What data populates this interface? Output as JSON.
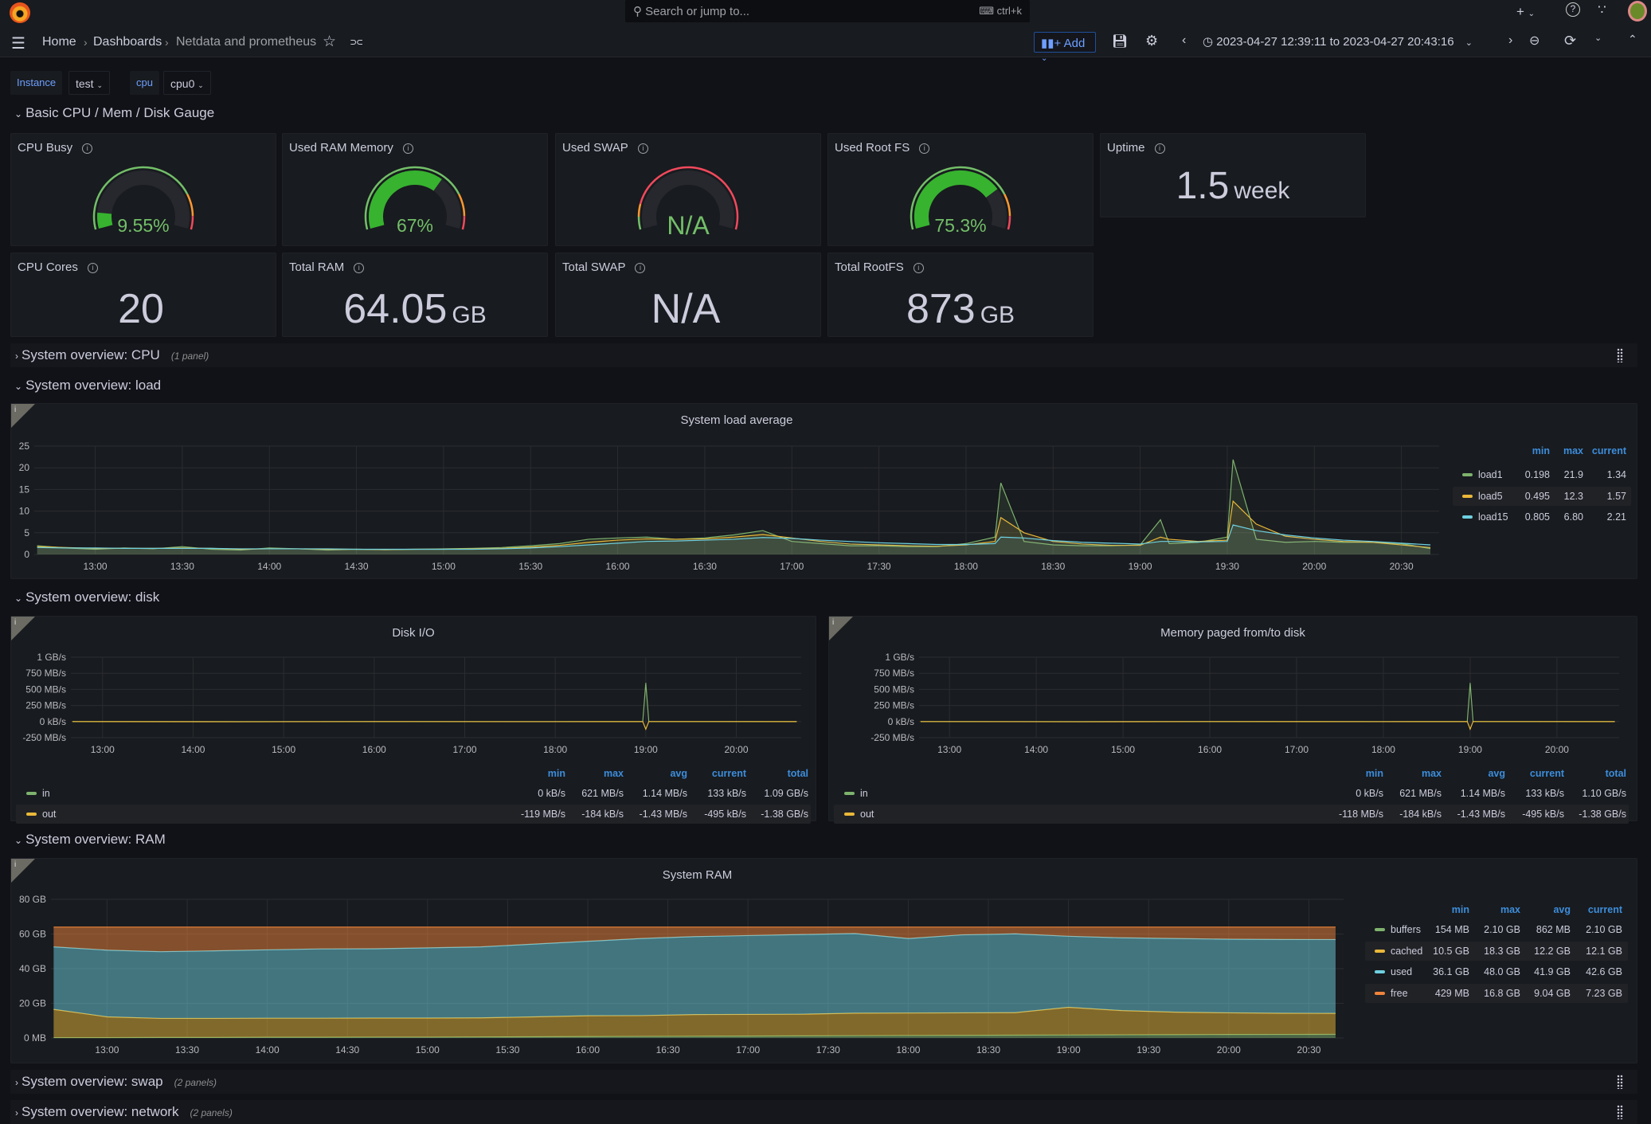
{
  "topbar": {
    "search_placeholder": "Search or jump to...",
    "search_shortcut": "ctrl+k",
    "new_label": "+",
    "icons": [
      "grafana-logo",
      "search-icon",
      "keyboard-icon",
      "plus-icon",
      "help-icon",
      "rss-icon",
      "avatar"
    ]
  },
  "nav": {
    "breadcrumbs": [
      "Home",
      "Dashboards",
      "Netdata and prometheus"
    ],
    "add_label": "Add",
    "time_range": "2023-04-27 12:39:11 to 2023-04-27 20:43:16",
    "accent": "#6e9fff"
  },
  "variables": [
    {
      "label": "Instance",
      "value": "test"
    },
    {
      "label": "cpu",
      "value": "cpu0"
    }
  ],
  "rows": {
    "basic": "Basic CPU / Mem / Disk Gauge",
    "cpu": {
      "title": "System overview: CPU",
      "count": "(1 panel)"
    },
    "load": "System overview: load",
    "disk": "System overview: disk",
    "ram": "System overview: RAM",
    "swap": {
      "title": "System overview: swap",
      "count": "(2 panels)"
    },
    "network": {
      "title": "System overview: network",
      "count": "(2 panels)"
    }
  },
  "gauges": [
    {
      "title": "CPU Busy",
      "value": "9.55%",
      "percent": 9.55
    },
    {
      "title": "Used RAM Memory",
      "value": "67%",
      "percent": 67
    },
    {
      "title": "Used SWAP",
      "value": "N/A",
      "percent": null
    },
    {
      "title": "Used Root FS",
      "value": "75.3%",
      "percent": 75.3
    }
  ],
  "stats": [
    {
      "title": "Uptime",
      "value": "1.5",
      "unit": "week"
    },
    {
      "title": "CPU Cores",
      "value": "20",
      "unit": ""
    },
    {
      "title": "Total RAM",
      "value": "64.05",
      "unit": "GB"
    },
    {
      "title": "Total SWAP",
      "value": "N/A",
      "unit": ""
    },
    {
      "title": "Total RootFS",
      "value": "873",
      "unit": "GB"
    }
  ],
  "panel_corner_label": "i",
  "chart_data": [
    {
      "type": "line",
      "title": "System load average",
      "xlim": [
        "12:39",
        "20:43"
      ],
      "ylim": [
        0,
        25
      ],
      "yticks": [
        {
          "v": 0,
          "label": "0"
        },
        {
          "v": 5,
          "label": "5"
        },
        {
          "v": 10,
          "label": "10"
        },
        {
          "v": 15,
          "label": "15"
        },
        {
          "v": 20,
          "label": "20"
        },
        {
          "v": 25,
          "label": "25"
        }
      ],
      "xticks": [
        "13:00",
        "13:30",
        "14:00",
        "14:30",
        "15:00",
        "15:30",
        "16:00",
        "16:30",
        "17:00",
        "17:30",
        "18:00",
        "18:30",
        "19:00",
        "19:30",
        "20:00",
        "20:30"
      ],
      "x": [
        "12:40",
        "12:50",
        "13:00",
        "13:10",
        "13:20",
        "13:30",
        "13:40",
        "13:50",
        "14:00",
        "14:10",
        "14:20",
        "14:30",
        "14:40",
        "14:50",
        "15:00",
        "15:10",
        "15:20",
        "15:30",
        "15:40",
        "15:50",
        "16:00",
        "16:10",
        "16:20",
        "16:30",
        "16:40",
        "16:50",
        "17:00",
        "17:10",
        "17:20",
        "17:30",
        "17:40",
        "17:50",
        "18:00",
        "18:10",
        "18:12",
        "18:20",
        "18:30",
        "18:40",
        "18:50",
        "19:00",
        "19:07",
        "19:10",
        "19:20",
        "19:30",
        "19:32",
        "19:40",
        "19:50",
        "20:00",
        "20:10",
        "20:20",
        "20:30",
        "20:40"
      ],
      "legend_columns": [
        "min",
        "max",
        "current"
      ],
      "series": [
        {
          "name": "load1",
          "color": "#7eb26d",
          "values": [
            2,
            1.5,
            1.2,
            1.5,
            1.3,
            1.8,
            1.2,
            1.0,
            1.5,
            1.3,
            1.0,
            1.2,
            1.1,
            1.2,
            1.3,
            1.4,
            1.6,
            2.0,
            2.5,
            3.5,
            3.8,
            4.0,
            3.5,
            3.8,
            4.5,
            5.5,
            3.0,
            2.5,
            2.0,
            2.0,
            1.8,
            1.8,
            2.5,
            4.0,
            16.5,
            3.0,
            2.2,
            2.0,
            2.0,
            2.2,
            8.0,
            2.5,
            2.8,
            4.0,
            21.9,
            3.5,
            2.8,
            3.0,
            2.8,
            2.8,
            2.5,
            1.34
          ],
          "stats": [
            "0.198",
            "21.9",
            "1.34"
          ]
        },
        {
          "name": "load5",
          "color": "#eab839",
          "values": [
            1.8,
            1.6,
            1.4,
            1.4,
            1.4,
            1.5,
            1.4,
            1.2,
            1.3,
            1.3,
            1.2,
            1.2,
            1.1,
            1.2,
            1.2,
            1.3,
            1.4,
            1.7,
            2.1,
            2.8,
            3.3,
            3.6,
            3.5,
            3.6,
            4.0,
            4.6,
            3.8,
            3.0,
            2.4,
            2.2,
            2.0,
            1.9,
            2.2,
            3.0,
            8.5,
            5.0,
            3.0,
            2.4,
            2.1,
            2.1,
            4.0,
            3.5,
            3.0,
            3.3,
            12.3,
            7.0,
            4.2,
            3.5,
            3.0,
            2.8,
            2.2,
            1.57
          ],
          "stats": [
            "0.495",
            "12.3",
            "1.57"
          ]
        },
        {
          "name": "load15",
          "color": "#6ed0e0",
          "values": [
            1.6,
            1.5,
            1.5,
            1.4,
            1.4,
            1.4,
            1.4,
            1.3,
            1.3,
            1.3,
            1.3,
            1.2,
            1.2,
            1.2,
            1.2,
            1.2,
            1.3,
            1.5,
            1.8,
            2.2,
            2.6,
            3.0,
            3.1,
            3.3,
            3.5,
            3.9,
            3.7,
            3.3,
            3.0,
            2.7,
            2.5,
            2.3,
            2.3,
            2.5,
            4.0,
            3.8,
            3.2,
            2.8,
            2.6,
            2.4,
            3.0,
            3.0,
            2.9,
            3.0,
            6.8,
            5.5,
            4.5,
            3.8,
            3.3,
            3.0,
            2.6,
            2.21
          ],
          "stats": [
            "0.805",
            "6.80",
            "2.21"
          ]
        }
      ]
    },
    {
      "type": "line",
      "title": "Disk I/O",
      "xlim": [
        "12:39",
        "20:43"
      ],
      "ylim": [
        -250,
        1000
      ],
      "yunit": "MB/s",
      "yticks": [
        {
          "v": -250,
          "label": "-250 MB/s"
        },
        {
          "v": 0,
          "label": "0 kB/s"
        },
        {
          "v": 250,
          "label": "250 MB/s"
        },
        {
          "v": 500,
          "label": "500 MB/s"
        },
        {
          "v": 750,
          "label": "750 MB/s"
        },
        {
          "v": 1000,
          "label": "1 GB/s"
        }
      ],
      "xticks": [
        "13:00",
        "14:00",
        "15:00",
        "16:00",
        "17:00",
        "18:00",
        "19:00",
        "20:00"
      ],
      "x": [
        "12:40",
        "14:30",
        "16:00",
        "18:00",
        "18:58",
        "19:00",
        "19:02",
        "20:40"
      ],
      "legend_columns": [
        "min",
        "max",
        "avg",
        "current",
        "total"
      ],
      "series": [
        {
          "name": "in",
          "color": "#7eb26d",
          "values": [
            0,
            0,
            0,
            0,
            0,
            600,
            0,
            0.13
          ],
          "stats": [
            "0 kB/s",
            "621 MB/s",
            "1.14 MB/s",
            "133 kB/s",
            "1.09 GB/s"
          ]
        },
        {
          "name": "out",
          "color": "#eab839",
          "values": [
            0,
            -3,
            0,
            -2,
            0,
            -119,
            0,
            -0.5
          ],
          "stats": [
            "-119 MB/s",
            "-184 kB/s",
            "-1.43 MB/s",
            "-495 kB/s",
            "-1.38 GB/s"
          ]
        }
      ]
    },
    {
      "type": "line",
      "title": "Memory paged from/to disk",
      "xlim": [
        "12:39",
        "20:43"
      ],
      "ylim": [
        -250,
        1000
      ],
      "yunit": "MB/s",
      "yticks": [
        {
          "v": -250,
          "label": "-250 MB/s"
        },
        {
          "v": 0,
          "label": "0 kB/s"
        },
        {
          "v": 250,
          "label": "250 MB/s"
        },
        {
          "v": 500,
          "label": "500 MB/s"
        },
        {
          "v": 750,
          "label": "750 MB/s"
        },
        {
          "v": 1000,
          "label": "1 GB/s"
        }
      ],
      "xticks": [
        "13:00",
        "14:00",
        "15:00",
        "16:00",
        "17:00",
        "18:00",
        "19:00",
        "20:00"
      ],
      "x": [
        "12:40",
        "14:30",
        "16:00",
        "18:00",
        "18:58",
        "19:00",
        "19:02",
        "20:40"
      ],
      "legend_columns": [
        "min",
        "max",
        "avg",
        "current",
        "total"
      ],
      "series": [
        {
          "name": "in",
          "color": "#7eb26d",
          "values": [
            0,
            0,
            0,
            0,
            0,
            600,
            0,
            0.13
          ],
          "stats": [
            "0 kB/s",
            "621 MB/s",
            "1.14 MB/s",
            "133 kB/s",
            "1.10 GB/s"
          ]
        },
        {
          "name": "out",
          "color": "#eab839",
          "values": [
            0,
            -3,
            0,
            -2,
            0,
            -118,
            0,
            -0.5
          ],
          "stats": [
            "-118 MB/s",
            "-184 kB/s",
            "-1.43 MB/s",
            "-495 kB/s",
            "-1.38 GB/s"
          ]
        }
      ]
    },
    {
      "type": "area",
      "stacked": true,
      "title": "System RAM",
      "xlim": [
        "12:39",
        "20:43"
      ],
      "ylim": [
        0,
        80
      ],
      "yunit": "GB",
      "yticks": [
        {
          "v": 0,
          "label": "0 MB"
        },
        {
          "v": 20,
          "label": "20 GB"
        },
        {
          "v": 40,
          "label": "40 GB"
        },
        {
          "v": 60,
          "label": "60 GB"
        },
        {
          "v": 80,
          "label": "80 GB"
        }
      ],
      "xticks": [
        "13:00",
        "13:30",
        "14:00",
        "14:30",
        "15:00",
        "15:30",
        "16:00",
        "16:30",
        "17:00",
        "17:30",
        "18:00",
        "18:30",
        "19:00",
        "19:30",
        "20:00",
        "20:30"
      ],
      "x": [
        "12:40",
        "13:00",
        "13:20",
        "13:40",
        "14:00",
        "14:20",
        "14:40",
        "15:00",
        "15:20",
        "15:40",
        "16:00",
        "16:20",
        "16:40",
        "17:00",
        "17:20",
        "17:40",
        "18:00",
        "18:20",
        "18:40",
        "19:00",
        "19:20",
        "19:40",
        "20:00",
        "20:20",
        "20:40"
      ],
      "legend_columns": [
        "min",
        "max",
        "avg",
        "current"
      ],
      "series": [
        {
          "name": "buffers",
          "color": "#7eb26d",
          "values": [
            0.2,
            0.2,
            0.3,
            0.3,
            0.4,
            0.4,
            0.5,
            0.5,
            0.6,
            0.7,
            0.8,
            0.9,
            1.0,
            1.1,
            1.2,
            1.3,
            1.4,
            1.5,
            1.6,
            1.7,
            1.8,
            1.9,
            2.0,
            2.05,
            2.1
          ],
          "stats": [
            "154 MB",
            "2.10 GB",
            "862 MB",
            "2.10 GB"
          ]
        },
        {
          "name": "cached",
          "color": "#eab839",
          "values": [
            16.3,
            12,
            11,
            11,
            11,
            11,
            11,
            11,
            11,
            11.5,
            12,
            12,
            12.5,
            12.5,
            12.5,
            13,
            13,
            13,
            13,
            16,
            14,
            13,
            12.5,
            12.2,
            12.1
          ],
          "stats": [
            "10.5 GB",
            "18.3 GB",
            "12.2 GB",
            "12.1 GB"
          ]
        },
        {
          "name": "used",
          "color": "#6ed0e0",
          "values": [
            36.1,
            38.5,
            38.5,
            39,
            39.5,
            40,
            40,
            40.5,
            41,
            42,
            43,
            44.5,
            45,
            45.5,
            46,
            46,
            43,
            45,
            45.5,
            41,
            42,
            42.5,
            42.5,
            42.6,
            42.6
          ],
          "stats": [
            "36.1 GB",
            "48.0 GB",
            "41.9 GB",
            "42.6 GB"
          ]
        },
        {
          "name": "free",
          "color": "#ef843c",
          "values": [
            11.4,
            13.3,
            14.2,
            13.7,
            13.1,
            12.6,
            12.5,
            12.0,
            11.4,
            9.8,
            8.2,
            6.6,
            5.5,
            4.9,
            4.3,
            3.7,
            6.6,
            4.5,
            3.9,
            5.3,
            6.2,
            6.6,
            7.0,
            7.15,
            7.2
          ],
          "stats": [
            "429 MB",
            "16.8 GB",
            "9.04 GB",
            "7.23 GB"
          ]
        }
      ]
    }
  ]
}
